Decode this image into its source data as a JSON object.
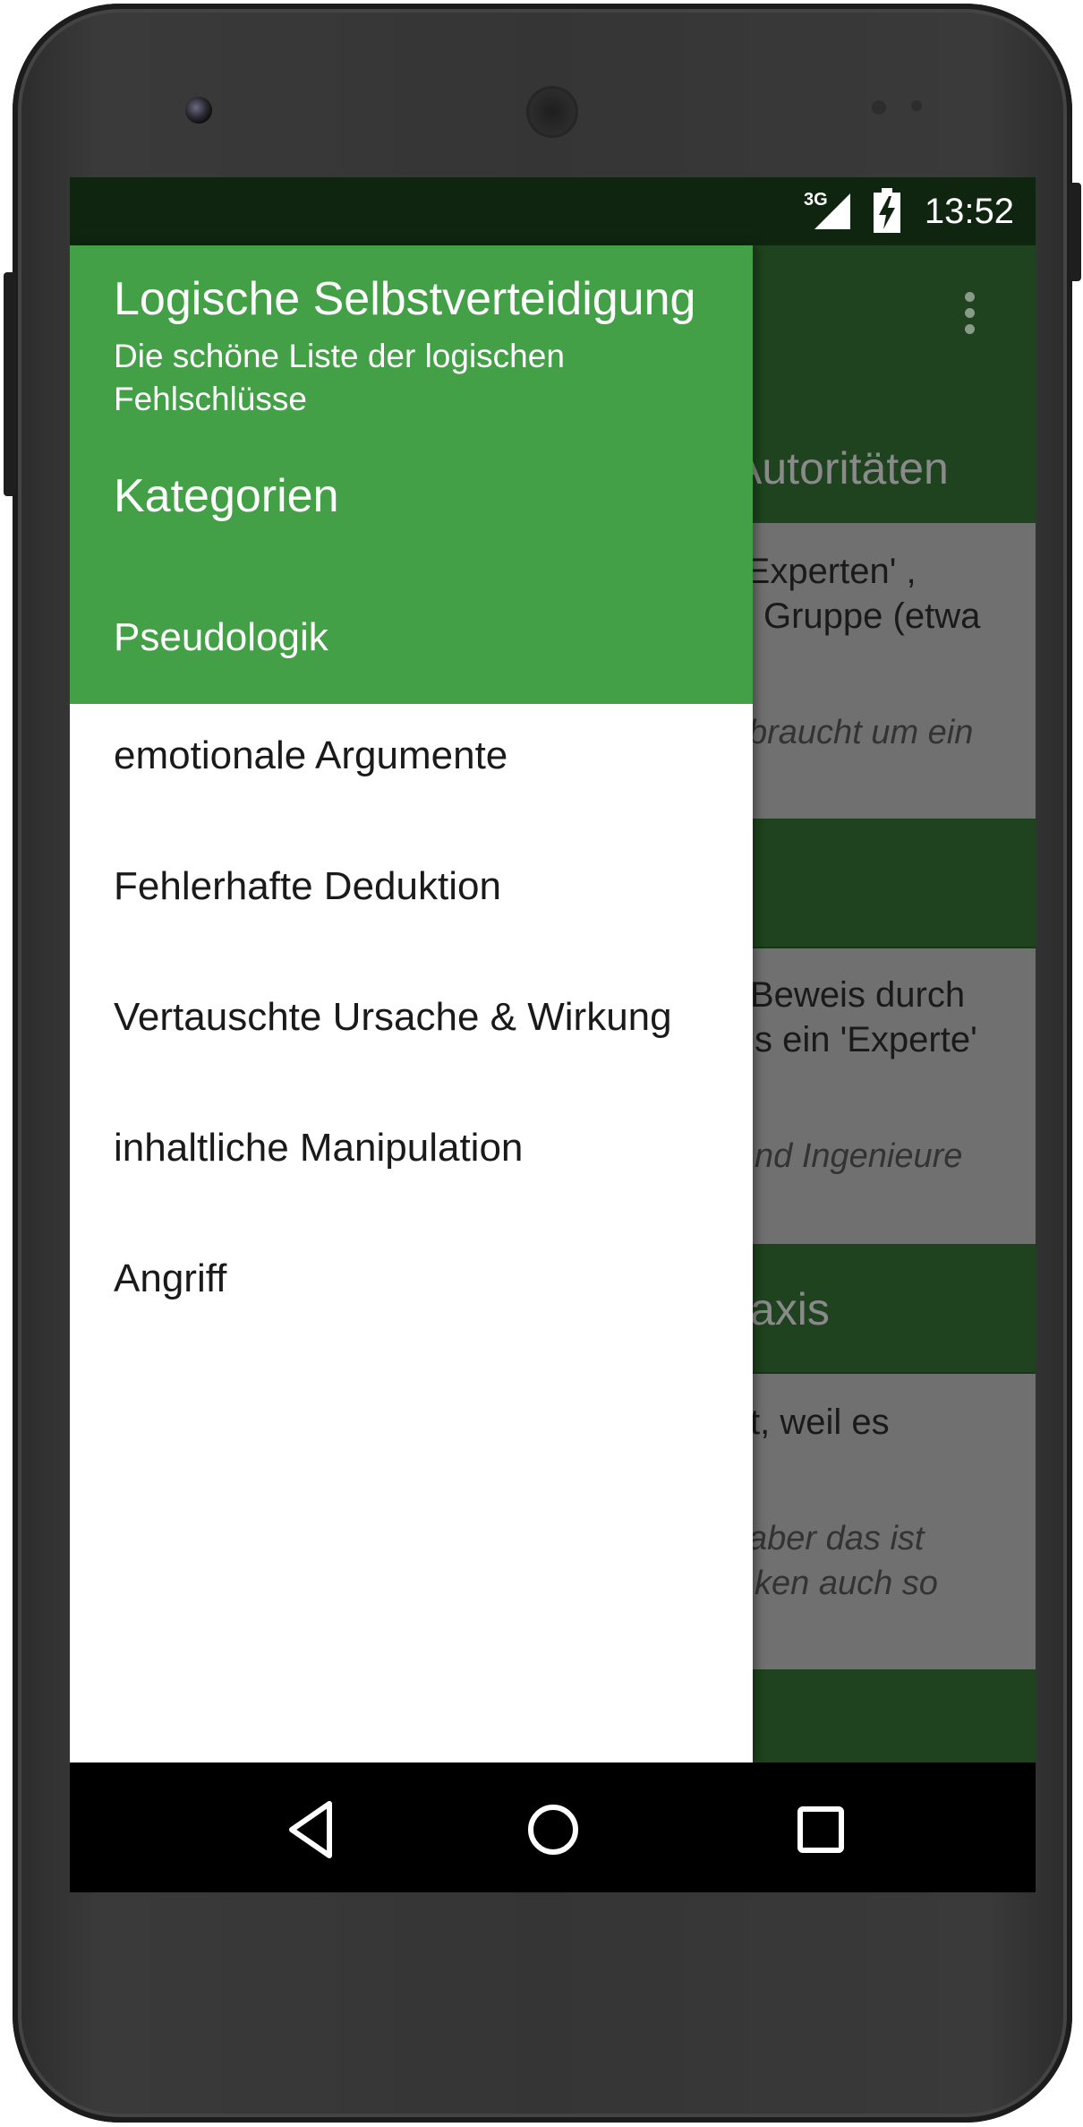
{
  "status_bar": {
    "network": "3G",
    "time": "13:52"
  },
  "background": {
    "sections": [
      {
        "header": "Autoritäten",
        "card_text": [
          "'Experten' ,",
          "Gruppe (etwa"
        ],
        "card_example": [
          "braucht um ein"
        ]
      },
      {
        "header": "",
        "card_text": [
          "Beweis durch",
          "s ein 'Experte'"
        ],
        "card_example": [
          "nd Ingenieure"
        ]
      },
      {
        "header": "axis",
        "card_text": [
          "t, weil es"
        ],
        "card_example": [
          "aber das ist",
          "ken auch so"
        ]
      }
    ]
  },
  "drawer": {
    "title": "Logische Selbstverteidigung",
    "subtitle": "Die schöne Liste der logischen Fehlschlüsse",
    "section_label": "Kategorien",
    "active_item": "Pseudologik",
    "items": [
      "emotionale Argumente",
      "Fehlerhafte Deduktion",
      "Vertauschte Ursache & Wirkung",
      "inhaltliche Manipulation",
      "Angriff"
    ]
  },
  "colors": {
    "drawer_header": "#43a047",
    "toolbar": "#1e431e",
    "status_bar": "#102510"
  },
  "icons": {
    "nav": [
      "back-icon",
      "home-icon",
      "recents-icon"
    ],
    "status": [
      "signal-3g-icon",
      "battery-charging-icon"
    ],
    "toolbar": [
      "overflow-menu-icon"
    ]
  }
}
